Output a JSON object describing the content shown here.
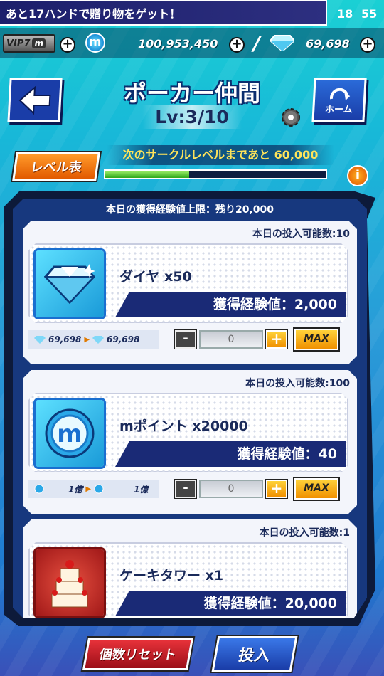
{
  "notice": "あと17ハンドで贈り物をゲット！",
  "clock": {
    "hour": "18",
    "minute": "55"
  },
  "vip": {
    "label": "VIP",
    "level": "7",
    "suffix": "m"
  },
  "currency": {
    "mpoints": "100,953,450",
    "diamonds": "69,698"
  },
  "header": {
    "title": "ポーカー仲間",
    "level": "Lv:3/10",
    "home": "ホーム"
  },
  "level_table_label": "レベル表",
  "next_level_text": "次のサークルレベルまであと 60,000",
  "xp_progress": 0.38,
  "daily_limit": "本日の獲得経験値上限：残り20,000",
  "items": [
    {
      "daily": "本日の投入可能数:10",
      "name": "ダイヤ x50",
      "xp": "獲得経験値：2,000",
      "bal_from": "69,698",
      "bal_to": "69,698",
      "qty": "0",
      "icon": "diamond-icon"
    },
    {
      "daily": "本日の投入可能数:100",
      "name": "mポイント x20000",
      "xp": "獲得経験値：40",
      "bal_from": "1億",
      "bal_to": "1億",
      "qty": "0",
      "icon": "m-coin-icon"
    },
    {
      "daily": "本日の投入可能数:1",
      "name": "ケーキタワー x1",
      "xp": "獲得経験値：20,000",
      "icon": "cake-tower-icon"
    }
  ],
  "buttons": {
    "minus": "-",
    "plus": "+",
    "max": "MAX",
    "reset": "個数リセット",
    "submit": "投入"
  }
}
